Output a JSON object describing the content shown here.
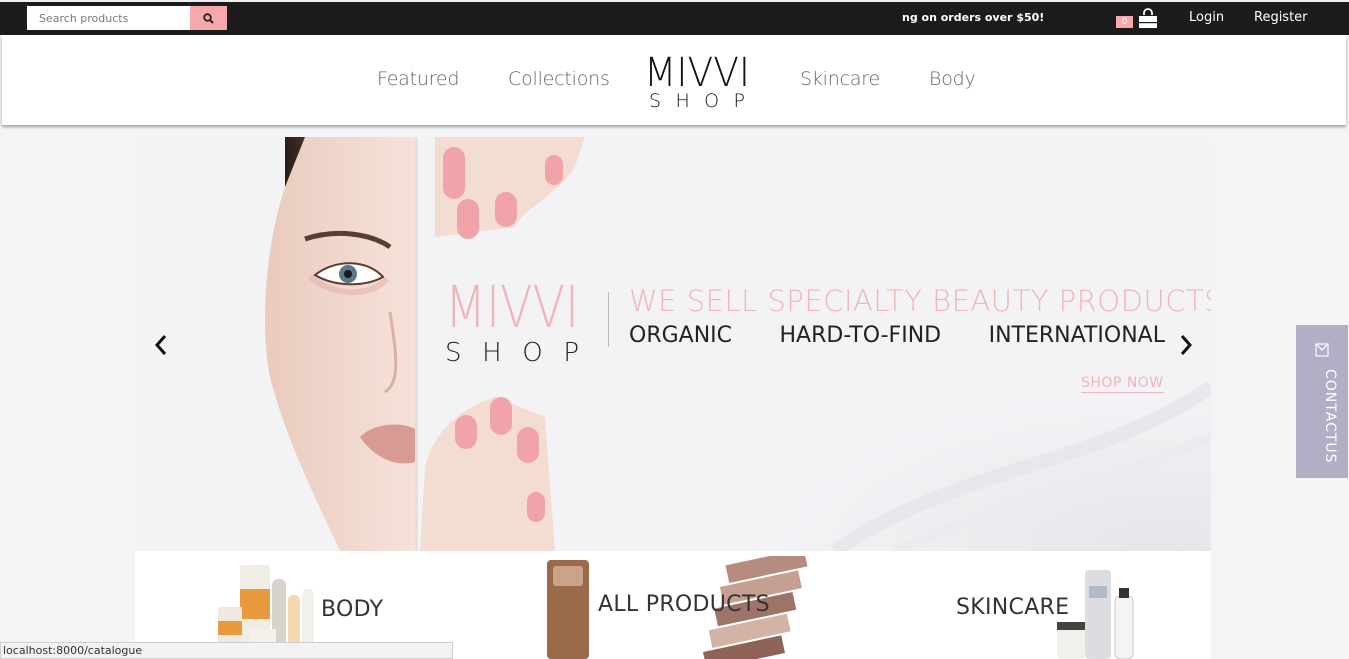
{
  "topbar": {
    "search_placeholder": "Search products",
    "promo_text": "ng on orders over $50!",
    "cart_count": "0",
    "login_label": "Login",
    "register_label": "Register"
  },
  "nav": {
    "featured": "Featured",
    "collections": "Collections",
    "skincare": "Skincare",
    "body": "Body",
    "logo_top": "MIVVI",
    "logo_bottom": "SHOP"
  },
  "hero": {
    "logo_top": "MIVVI",
    "logo_bottom": "SHOP",
    "headline": "WE SELL SPECIALTY BEAUTY PRODUCTS",
    "tags": [
      "ORGANIC",
      "HARD-TO-FIND",
      "INTERNATIONAL"
    ],
    "cta": "SHOP NOW"
  },
  "categories": {
    "body": "BODY",
    "all_products": "ALL PRODUCTS",
    "skincare": "SKINCARE"
  },
  "contact": {
    "label": "CONTACTUS"
  },
  "status_bar": {
    "url": "localhost:8000/catalogue"
  },
  "colors": {
    "accent_pink": "#f5a9ad",
    "headline_pink": "#f1b5b8",
    "contact_purple": "#b3aec6",
    "topbar_bg": "#1c1c1c"
  }
}
